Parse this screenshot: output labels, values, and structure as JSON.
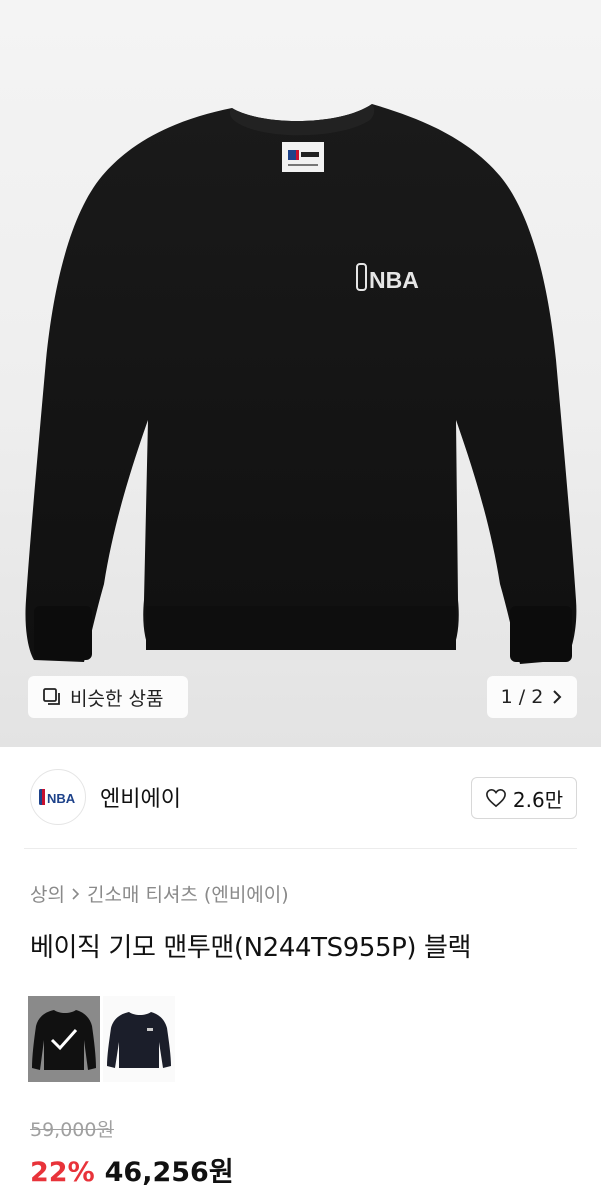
{
  "hero": {
    "similar_label": "비슷한 상품",
    "pager_text": "1 / 2",
    "product_logo_text": "NBA"
  },
  "brand": {
    "name": "엔비에이",
    "logo_text": "NBA",
    "like_count": "2.6만"
  },
  "breadcrumb": {
    "category": "상의",
    "subcategory": "긴소매 티셔츠 (엔비에이)"
  },
  "product": {
    "title": "베이직 기모 맨투맨(N244TS955P) 블랙"
  },
  "price": {
    "original": "59,000원",
    "discount": "22%",
    "final": "46,256원"
  },
  "colors": {
    "discount_red": "#e8333a",
    "sweater_black": "#141414",
    "nba_blue": "#1d428a",
    "nba_red": "#c8102e"
  }
}
